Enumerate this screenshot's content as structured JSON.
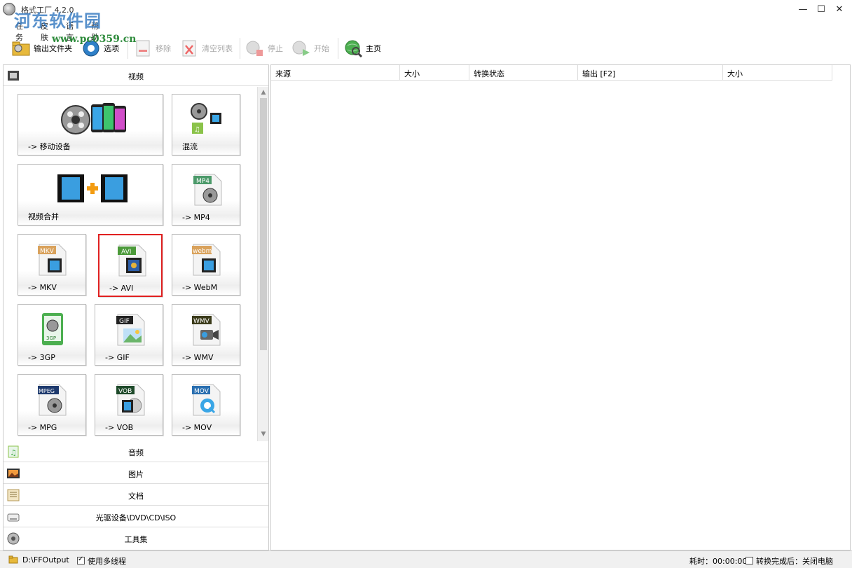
{
  "window": {
    "title": "格式工厂 4.2.0",
    "watermark": "河东软件园",
    "watermark_url": "www.pc0359.cn"
  },
  "menu": [
    "任务",
    "皮肤",
    "语言",
    "帮助"
  ],
  "toolbar": {
    "output_folder": "输出文件夹",
    "options": "选项",
    "remove": "移除",
    "clear_list": "清空列表",
    "stop": "停止",
    "start": "开始",
    "home": "主页"
  },
  "categories": {
    "video": "视频",
    "audio": "音频",
    "image": "图片",
    "document": "文档",
    "rom": "光驱设备\\DVD\\CD\\ISO",
    "tools": "工具集"
  },
  "tiles": {
    "mobile": "-> 移动设备",
    "mux": "混流",
    "join": "视频合并",
    "mp4": "-> MP4",
    "mkv": "-> MKV",
    "avi": "-> AVI",
    "webm": "-> WebM",
    "3gp": "-> 3GP",
    "gif": "-> GIF",
    "wmv": "-> WMV",
    "mpg": "-> MPG",
    "vob": "-> VOB",
    "mov": "-> MOV"
  },
  "tile_badges": {
    "mp4": "MP4",
    "mkv": "MKV",
    "avi": "AVI",
    "webm": "webm",
    "3gp": "3GP",
    "gif": "GIF",
    "wmv": "WMV",
    "mpeg": "MPEG",
    "vob": "VOB",
    "mov": "MOV"
  },
  "columns": [
    "来源",
    "大小",
    "转换状态",
    "输出 [F2]",
    "大小"
  ],
  "status": {
    "output_path": "D:\\FFOutput",
    "multithread": "使用多线程",
    "elapsed": "耗时：00:00:00",
    "after_done": "转换完成后：关闭电脑"
  },
  "colors": {
    "selection": "#e02020",
    "accent": "#3d7ec3"
  }
}
